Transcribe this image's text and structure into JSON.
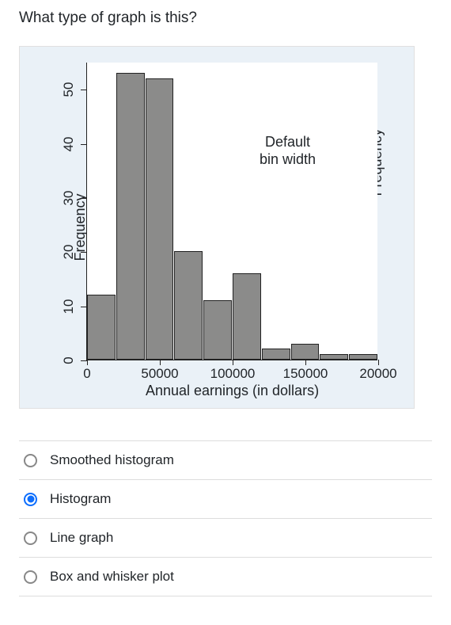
{
  "question": "What type of graph is this?",
  "chart_data": {
    "type": "bar",
    "title": "",
    "xlabel": "Annual earnings (in dollars)",
    "ylabel": "Frequency",
    "ylabel_right": "Frequency",
    "annotation": "Default\nbin width",
    "ylim": [
      0,
      55
    ],
    "y_ticks": [
      0,
      10,
      20,
      30,
      40,
      50
    ],
    "x_ticks": [
      0,
      50000,
      100000,
      150000,
      200000
    ],
    "x_tick_labels": [
      "0",
      "50000",
      "100000",
      "150000",
      "20000"
    ],
    "categories": [
      0,
      20000,
      40000,
      60000,
      80000,
      100000,
      120000,
      140000,
      160000,
      180000
    ],
    "values": [
      12,
      53,
      52,
      20,
      11,
      16,
      2,
      3,
      1,
      1
    ]
  },
  "options": [
    {
      "label": "Smoothed histogram",
      "selected": false
    },
    {
      "label": "Histogram",
      "selected": true
    },
    {
      "label": "Line graph",
      "selected": false
    },
    {
      "label": "Box and whisker plot",
      "selected": false
    }
  ]
}
